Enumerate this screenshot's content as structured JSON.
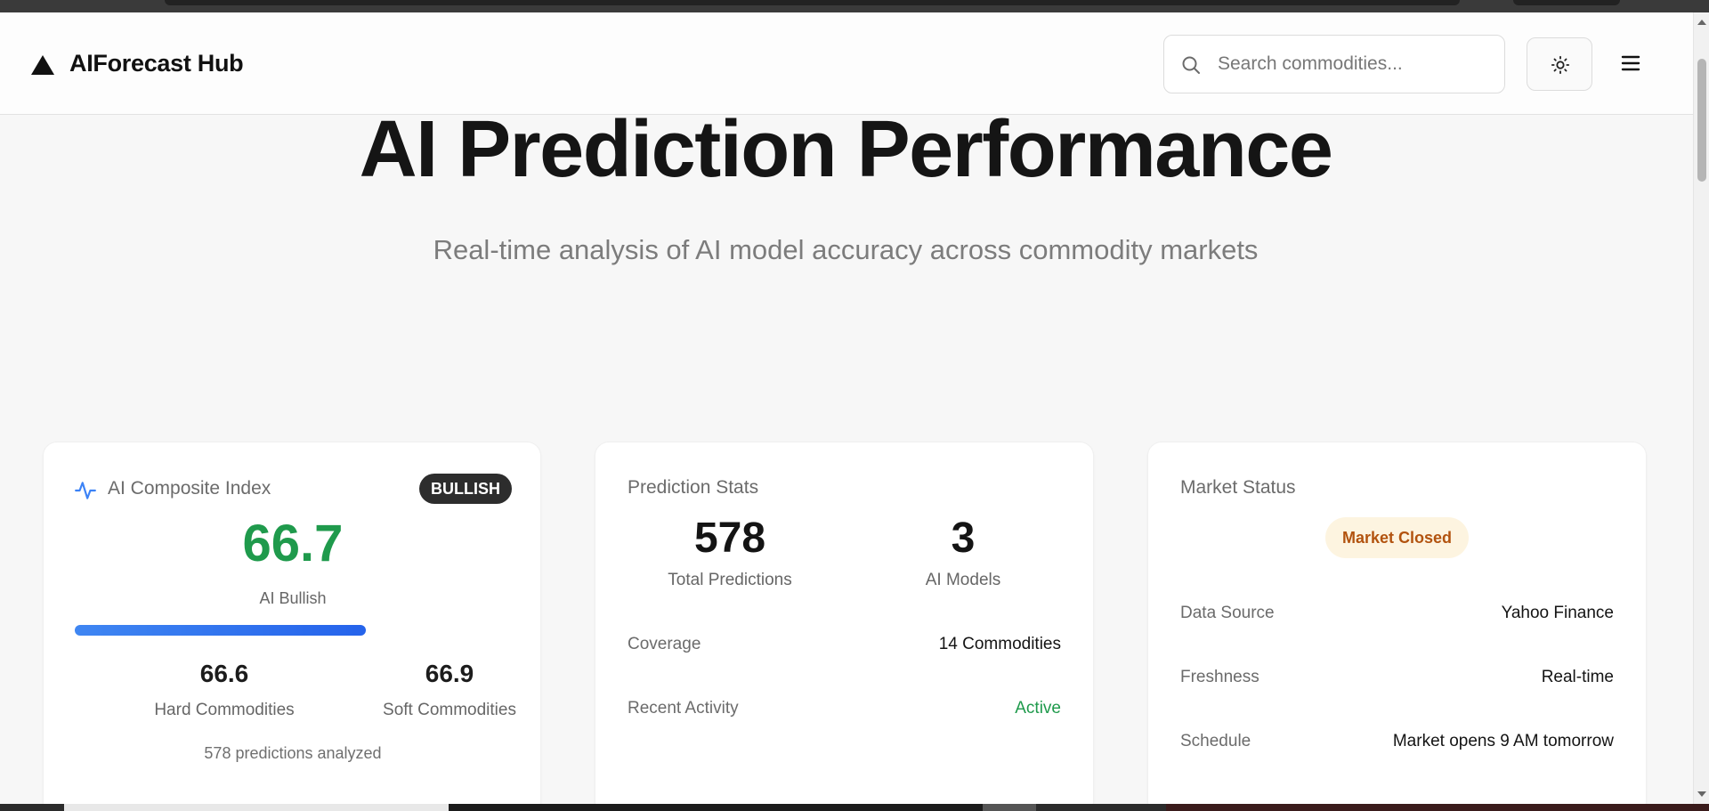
{
  "header": {
    "brand": "AIForecast Hub",
    "search_placeholder": "Search commodities..."
  },
  "hero": {
    "title": "AI Prediction Performance",
    "subtitle": "Real-time analysis of AI model accuracy across commodity markets"
  },
  "composite": {
    "title": "AI Composite Index",
    "badge": "BULLISH",
    "value": "66.7",
    "label": "AI Bullish",
    "progress_percent": 66.7,
    "hard_value": "66.6",
    "hard_label": "Hard Commodities",
    "soft_value": "66.9",
    "soft_label": "Soft Commodities",
    "footnote": "578 predictions analyzed",
    "colors": {
      "value": "#1f9a4c",
      "progress": "#2563eb"
    }
  },
  "stats": {
    "title": "Prediction Stats",
    "total_value": "578",
    "total_label": "Total Predictions",
    "models_value": "3",
    "models_label": "AI Models",
    "rows": [
      {
        "label": "Coverage",
        "value": "14 Commodities"
      },
      {
        "label": "Recent Activity",
        "value": "Active"
      }
    ]
  },
  "market": {
    "title": "Market Status",
    "status": "Market Closed",
    "rows": [
      {
        "label": "Data Source",
        "value": "Yahoo Finance"
      },
      {
        "label": "Freshness",
        "value": "Real-time"
      },
      {
        "label": "Schedule",
        "value": "Market opens 9 AM tomorrow"
      }
    ]
  }
}
